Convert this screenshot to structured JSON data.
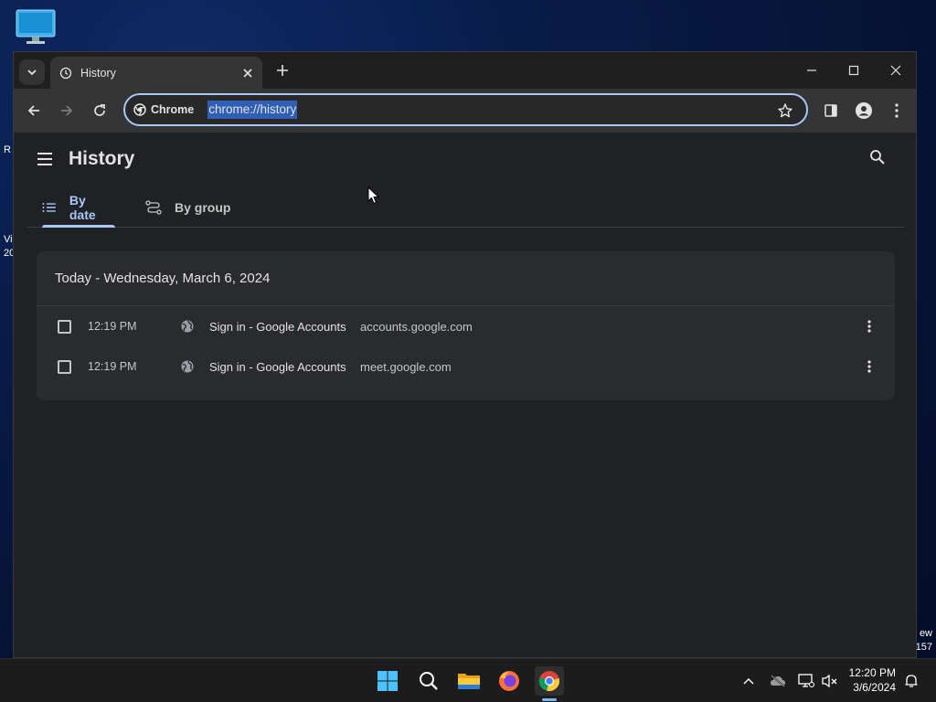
{
  "desktop": {
    "fragments_left": [
      "R",
      "Vi",
      "20"
    ],
    "fragments_right": [
      "ew",
      "157"
    ]
  },
  "browser": {
    "tab": {
      "title": "History",
      "icon": "history-icon"
    },
    "window_controls": [
      "minimize-icon",
      "maximize-icon",
      "close-icon"
    ],
    "omnibox": {
      "chip_label": "Chrome",
      "url": "chrome://history"
    }
  },
  "history": {
    "title": "History",
    "tabs": [
      {
        "label": "By date",
        "selected": true
      },
      {
        "label": "By group",
        "selected": false
      }
    ],
    "day_header": "Today - Wednesday, March 6, 2024",
    "entries": [
      {
        "time": "12:19 PM",
        "title": "Sign in - Google Accounts",
        "domain": "accounts.google.com"
      },
      {
        "time": "12:19 PM",
        "title": "Sign in - Google Accounts",
        "domain": "meet.google.com"
      }
    ]
  },
  "taskbar": {
    "clock": {
      "time": "12:20 PM",
      "date": "3/6/2024"
    },
    "apps": [
      "windows-start-icon",
      "search-icon",
      "file-explorer-icon",
      "firefox-icon",
      "chrome-icon"
    ]
  },
  "colors": {
    "accent": "#a8c7fa",
    "page_bg": "#202124",
    "card_bg": "#2a2b2e",
    "toolbar_bg": "#353535",
    "url_highlight": "#2e5fb5"
  }
}
